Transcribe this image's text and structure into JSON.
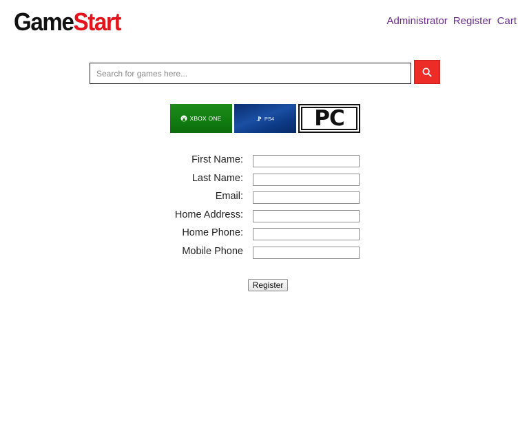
{
  "header": {
    "logo_part1": "Game",
    "logo_part2": "Start",
    "nav": {
      "administrator": "Administrator",
      "register": "Register",
      "cart": "Cart"
    }
  },
  "search": {
    "placeholder": "Search for games here...",
    "value": "",
    "icon": "search-icon"
  },
  "platforms": {
    "xbox": "XBOX ONE",
    "ps4": "PS4",
    "pc": "PC"
  },
  "form": {
    "fields": [
      {
        "label": "First Name:",
        "value": ""
      },
      {
        "label": "Last Name:",
        "value": ""
      },
      {
        "label": "Email:",
        "value": ""
      },
      {
        "label": "Home Address:",
        "value": ""
      },
      {
        "label": "Home Phone:",
        "value": ""
      },
      {
        "label": "Mobile Phone",
        "value": ""
      }
    ],
    "submit_label": "Register"
  },
  "colors": {
    "brand_red": "#e3141b",
    "link_purple": "#6b2c8f",
    "search_button": "#ee2c27",
    "xbox_green": "#107c10",
    "ps_blue": "#0d3a86"
  }
}
